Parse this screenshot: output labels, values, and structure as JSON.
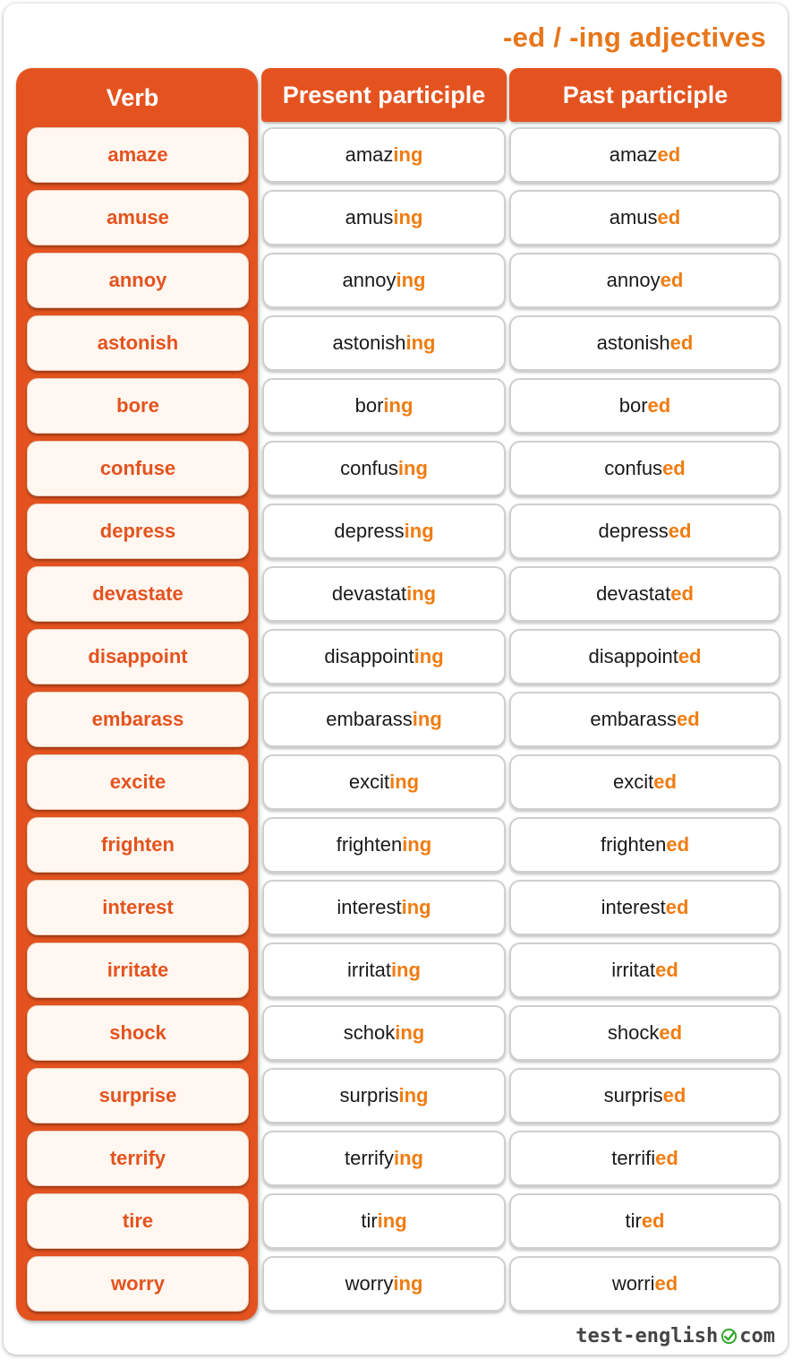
{
  "title": "-ed / -ing adjectives",
  "headers": {
    "verb": "Verb",
    "present": "Present participle",
    "past": "Past participle"
  },
  "rows": [
    {
      "verb": "amaze",
      "present_stem": "amaz",
      "present_suffix": "ing",
      "past_stem": "amaz",
      "past_suffix": "ed"
    },
    {
      "verb": "amuse",
      "present_stem": "amus",
      "present_suffix": "ing",
      "past_stem": "amus",
      "past_suffix": "ed"
    },
    {
      "verb": "annoy",
      "present_stem": "annoy",
      "present_suffix": "ing",
      "past_stem": "annoy",
      "past_suffix": "ed"
    },
    {
      "verb": "astonish",
      "present_stem": "astonish",
      "present_suffix": "ing",
      "past_stem": "astonish",
      "past_suffix": "ed"
    },
    {
      "verb": "bore",
      "present_stem": "bor",
      "present_suffix": "ing",
      "past_stem": "bor",
      "past_suffix": "ed"
    },
    {
      "verb": "confuse",
      "present_stem": "confus",
      "present_suffix": "ing",
      "past_stem": "confus",
      "past_suffix": "ed"
    },
    {
      "verb": "depress",
      "present_stem": "depress",
      "present_suffix": "ing",
      "past_stem": "depress",
      "past_suffix": "ed"
    },
    {
      "verb": "devastate",
      "present_stem": "devastat",
      "present_suffix": "ing",
      "past_stem": "devastat",
      "past_suffix": "ed"
    },
    {
      "verb": "disappoint",
      "present_stem": "disappoint",
      "present_suffix": "ing",
      "past_stem": "disappoint",
      "past_suffix": "ed"
    },
    {
      "verb": "embarass",
      "present_stem": "embarass",
      "present_suffix": "ing",
      "past_stem": "embarass",
      "past_suffix": "ed"
    },
    {
      "verb": "excite",
      "present_stem": "excit",
      "present_suffix": "ing",
      "past_stem": "excit",
      "past_suffix": "ed"
    },
    {
      "verb": "frighten",
      "present_stem": "frighten",
      "present_suffix": "ing",
      "past_stem": "frighten",
      "past_suffix": "ed"
    },
    {
      "verb": "interest",
      "present_stem": "interest",
      "present_suffix": "ing",
      "past_stem": "interest",
      "past_suffix": "ed"
    },
    {
      "verb": "irritate",
      "present_stem": "irritat",
      "present_suffix": "ing",
      "past_stem": "irritat",
      "past_suffix": "ed"
    },
    {
      "verb": "shock",
      "present_stem": "schok",
      "present_suffix": "ing",
      "past_stem": "shock",
      "past_suffix": "ed"
    },
    {
      "verb": "surprise",
      "present_stem": "surpris",
      "present_suffix": "ing",
      "past_stem": "surpris",
      "past_suffix": "ed"
    },
    {
      "verb": "terrify",
      "present_stem": "terrify",
      "present_suffix": "ing",
      "past_stem": "terrifi",
      "past_suffix": "ed"
    },
    {
      "verb": "tire",
      "present_stem": "tir",
      "present_suffix": "ing",
      "past_stem": "tir",
      "past_suffix": "ed"
    },
    {
      "verb": "worry",
      "present_stem": "worry",
      "present_suffix": "ing",
      "past_stem": "worri",
      "past_suffix": "ed"
    }
  ],
  "logo": {
    "left": "test-english",
    "right": "com",
    "icon": "check-circle-icon"
  },
  "colors": {
    "accent": "#e4531f",
    "suffix": "#f07c10",
    "title": "#e8761a"
  }
}
